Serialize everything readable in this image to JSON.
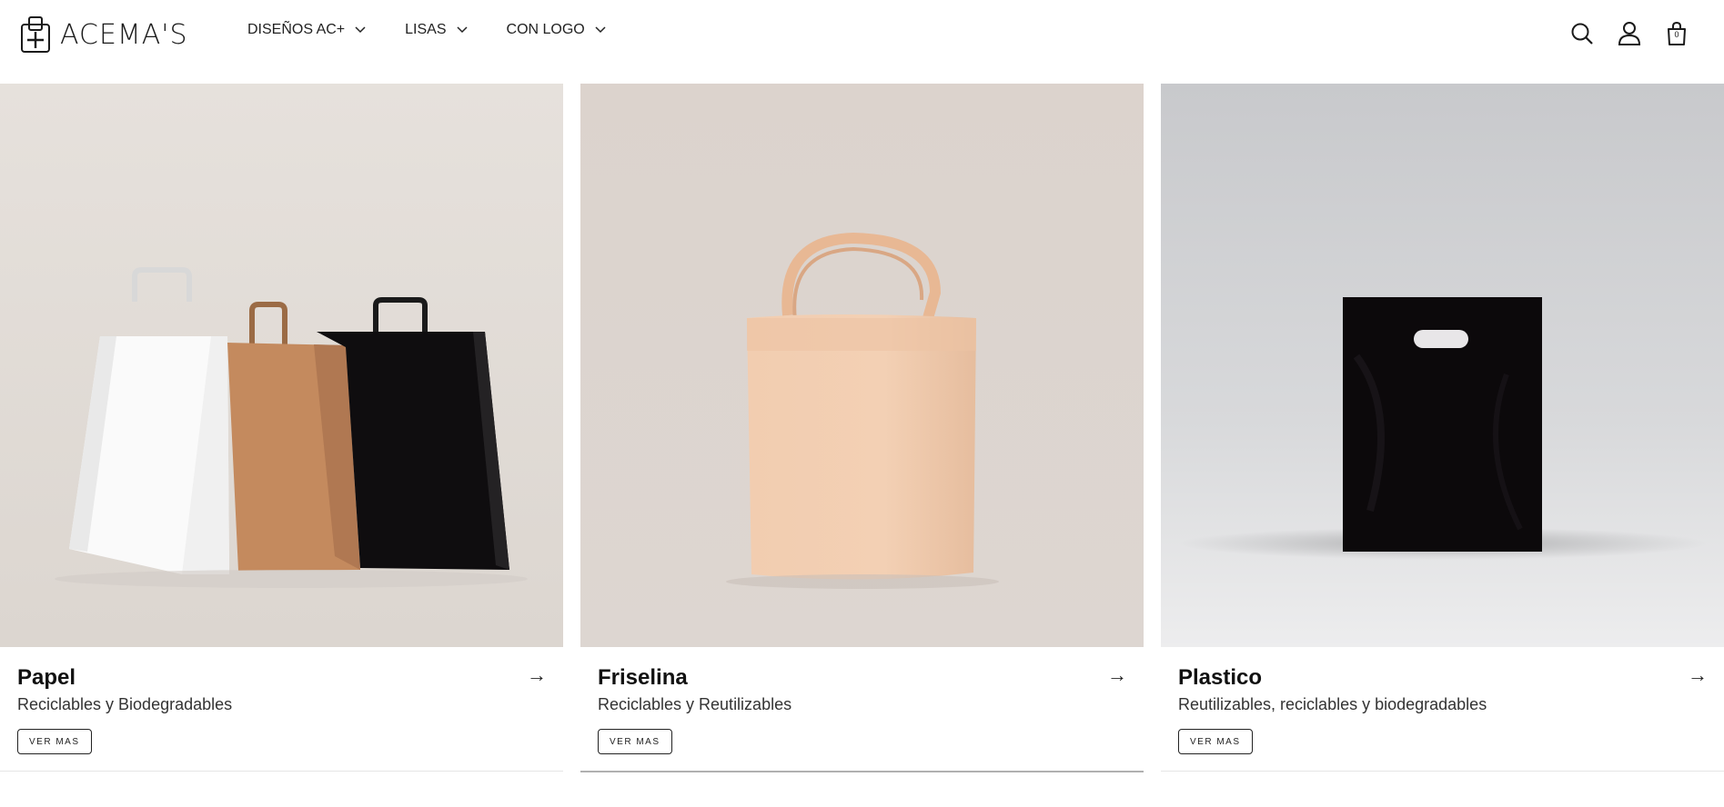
{
  "brand": {
    "name": "ACEMA'S"
  },
  "nav": [
    {
      "label": "DISEÑOS AC+"
    },
    {
      "label": "LISAS"
    },
    {
      "label": "CON LOGO"
    }
  ],
  "header_icons": [
    "search-icon",
    "account-icon",
    "cart-icon"
  ],
  "cart": {
    "count": "0"
  },
  "cards": [
    {
      "title": "Papel",
      "subtitle": "Reciclables y Biodegradables",
      "button": "VER MAS",
      "arrow": "→"
    },
    {
      "title": "Friselina",
      "subtitle": "Reciclables y Reutilizables",
      "button": "VER MAS",
      "arrow": "→"
    },
    {
      "title": "Plastico",
      "subtitle": "Reutilizables, reciclables y biodegradables",
      "button": "VER MAS",
      "arrow": "→"
    }
  ],
  "colors": {
    "text": "#111111",
    "paper_bg": "#e4dfda",
    "friselina_bg": "#dcd5cf",
    "plastico_bg": "#c9cacd",
    "kraft": "#b8835a",
    "friselina_bag": "#f0c8a8",
    "black_bag": "#0c0a0c"
  }
}
